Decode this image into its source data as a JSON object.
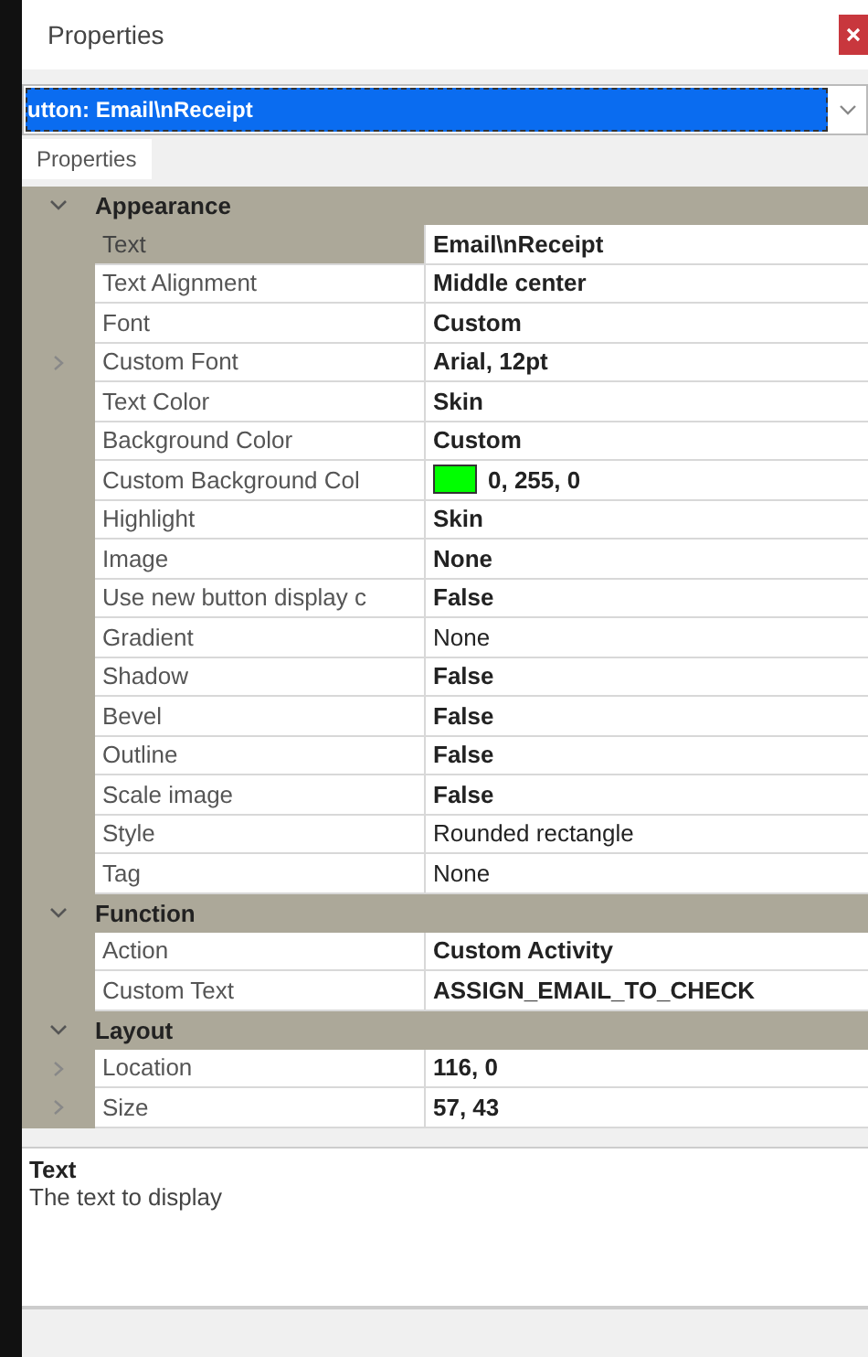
{
  "window": {
    "title": "Properties"
  },
  "object_selector": {
    "value": "utton: Email\\nReceipt"
  },
  "tabs": [
    {
      "label": "Properties",
      "selected": true
    }
  ],
  "categories": [
    {
      "name": "Appearance",
      "expanded": true,
      "properties": [
        {
          "name": "Text",
          "value": "Email\\nReceipt",
          "bold": true,
          "selected": true,
          "expandable": false
        },
        {
          "name": "Text Alignment",
          "value": "Middle center",
          "bold": true,
          "selected": false,
          "expandable": false
        },
        {
          "name": "Font",
          "value": "Custom",
          "bold": true,
          "selected": false,
          "expandable": false
        },
        {
          "name": "Custom Font",
          "value": "Arial, 12pt",
          "bold": true,
          "selected": false,
          "expandable": true
        },
        {
          "name": "Text Color",
          "value": "Skin",
          "bold": true,
          "selected": false,
          "expandable": false
        },
        {
          "name": "Background Color",
          "value": "Custom",
          "bold": true,
          "selected": false,
          "expandable": false
        },
        {
          "name": "Custom Background Col",
          "value": "0, 255, 0",
          "bold": true,
          "selected": false,
          "expandable": false,
          "color": "#00ff00"
        },
        {
          "name": "Highlight",
          "value": "Skin",
          "bold": true,
          "selected": false,
          "expandable": false
        },
        {
          "name": "Image",
          "value": "None",
          "bold": true,
          "selected": false,
          "expandable": false
        },
        {
          "name": "Use new button display c",
          "value": "False",
          "bold": true,
          "selected": false,
          "expandable": false
        },
        {
          "name": "Gradient",
          "value": "None",
          "bold": false,
          "selected": false,
          "expandable": false
        },
        {
          "name": "Shadow",
          "value": "False",
          "bold": true,
          "selected": false,
          "expandable": false
        },
        {
          "name": "Bevel",
          "value": "False",
          "bold": true,
          "selected": false,
          "expandable": false
        },
        {
          "name": "Outline",
          "value": "False",
          "bold": true,
          "selected": false,
          "expandable": false
        },
        {
          "name": "Scale image",
          "value": "False",
          "bold": true,
          "selected": false,
          "expandable": false
        },
        {
          "name": "Style",
          "value": "Rounded rectangle",
          "bold": false,
          "selected": false,
          "expandable": false
        },
        {
          "name": "Tag",
          "value": "None",
          "bold": false,
          "selected": false,
          "expandable": false
        }
      ]
    },
    {
      "name": "Function",
      "expanded": true,
      "properties": [
        {
          "name": "Action",
          "value": "Custom Activity",
          "bold": true,
          "selected": false,
          "expandable": false
        },
        {
          "name": "Custom Text",
          "value": "ASSIGN_EMAIL_TO_CHECK",
          "bold": true,
          "selected": false,
          "expandable": false
        }
      ]
    },
    {
      "name": "Layout",
      "expanded": true,
      "properties": [
        {
          "name": "Location",
          "value": "116, 0",
          "bold": true,
          "selected": false,
          "expandable": true
        },
        {
          "name": "Size",
          "value": "57, 43",
          "bold": true,
          "selected": false,
          "expandable": true
        }
      ]
    }
  ],
  "description": {
    "title": "Text",
    "text": "The text to display"
  }
}
